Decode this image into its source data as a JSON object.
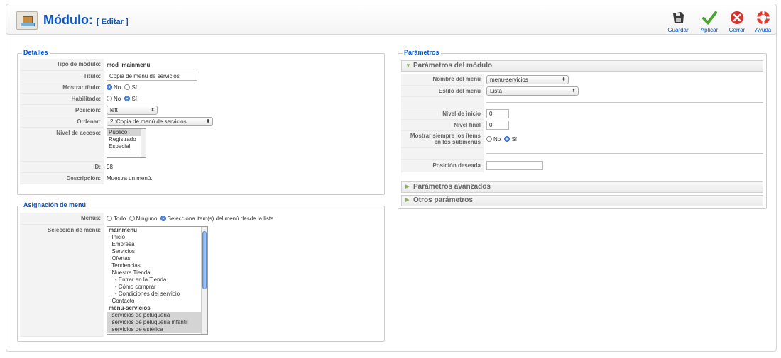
{
  "header": {
    "title": "Módulo:",
    "subtitle": "[ Editar ]"
  },
  "toolbar": {
    "save_label": "Guardar",
    "apply_label": "Aplicar",
    "close_label": "Cerrar",
    "help_label": "Ayuda"
  },
  "details": {
    "legend": "Detalles",
    "type_label": "Tipo de módulo:",
    "type_value": "mod_mainmenu",
    "title_label": "Título:",
    "title_value": "Copia de menú de servicios",
    "show_title_label": "Mostrar título:",
    "show_title_no": "No",
    "show_title_yes": "Sí",
    "enabled_label": "Habilitado:",
    "enabled_no": "No",
    "enabled_yes": "Sí",
    "position_label": "Posición:",
    "position_value": "left",
    "order_label": "Ordenar:",
    "order_value": "2::Copia de menú de servicios",
    "access_label": "Nivel de acceso:",
    "access_options": [
      "Público",
      "Registrado",
      "Especial"
    ],
    "id_label": "ID:",
    "id_value": "98",
    "description_label": "Descripción:",
    "description_value": "Muestra un menú."
  },
  "assignment": {
    "legend": "Asignación de menú",
    "menus_label": "Menús:",
    "opt_all": "Todo",
    "opt_none": "Ninguno",
    "opt_select": "Selecciona item(s) del menú desde la lista",
    "selection_label": "Selección de menú:",
    "items": [
      {
        "text": "mainmenu",
        "group": true,
        "selected": false
      },
      {
        "text": "  Inicio",
        "group": false,
        "selected": false
      },
      {
        "text": "  Empresa",
        "group": false,
        "selected": false
      },
      {
        "text": "  Servicios",
        "group": false,
        "selected": false
      },
      {
        "text": "  Ofertas",
        "group": false,
        "selected": false
      },
      {
        "text": "  Tendencias",
        "group": false,
        "selected": false
      },
      {
        "text": "  Nuestra Tienda",
        "group": false,
        "selected": false
      },
      {
        "text": "    - Entrar en la Tienda",
        "group": false,
        "selected": false
      },
      {
        "text": "    - Cómo comprar",
        "group": false,
        "selected": false
      },
      {
        "text": "    - Condiciones del servicio",
        "group": false,
        "selected": false
      },
      {
        "text": "  Contacto",
        "group": false,
        "selected": false
      },
      {
        "text": "menu-servicios",
        "group": true,
        "selected": false
      },
      {
        "text": "  servicios de peluqueria",
        "group": false,
        "selected": true
      },
      {
        "text": "  servicios de peluqueria infantil",
        "group": false,
        "selected": true
      },
      {
        "text": "  servicios de estética",
        "group": false,
        "selected": true
      }
    ]
  },
  "params": {
    "legend": "Parámetros",
    "module_params_label": "Parámetros del módulo",
    "menu_name_label": "Nombre del menú",
    "menu_name_value": "menu-servicios",
    "menu_style_label": "Estilo del menú",
    "menu_style_value": "Lista",
    "start_level_label": "Nivel de inicio",
    "start_level_value": "0",
    "end_level_label": "Nivel final",
    "end_level_value": "0",
    "always_show_label_1": "Mostrar siempre los ítems",
    "always_show_label_2": "en los submenús",
    "always_show_no": "No",
    "always_show_yes": "Sí",
    "desired_position_label": "Posición deseada",
    "desired_position_value": "",
    "advanced_label": "Parámetros avanzados",
    "other_label": "Otros parámetros"
  }
}
